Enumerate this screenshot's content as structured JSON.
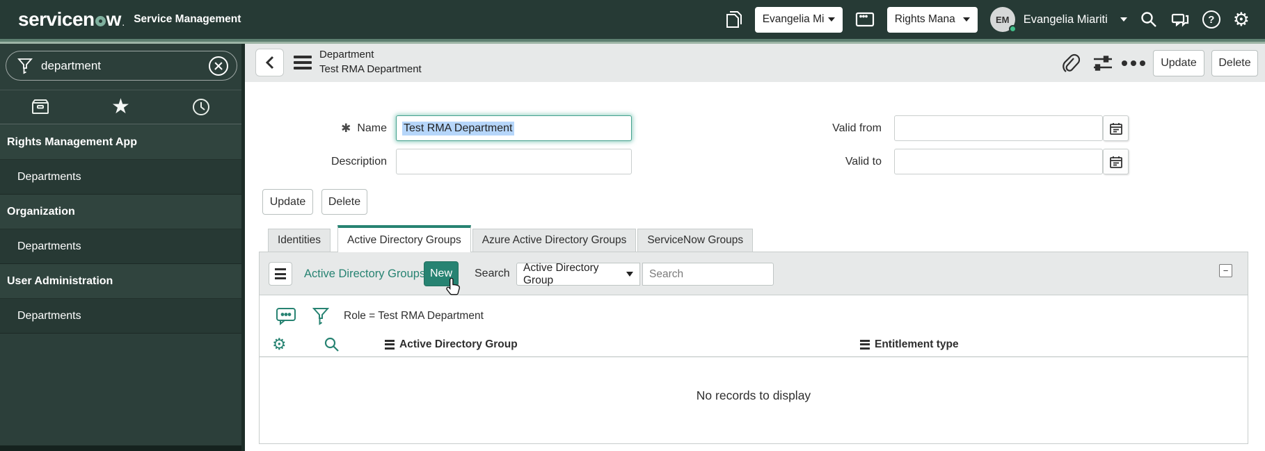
{
  "header": {
    "logo_text_pre": "servicen",
    "logo_text_post": "w",
    "logo_tm": ".",
    "product_name": "Service Management",
    "update_set_picker": "Evangelia Mi",
    "app_picker": "Rights Mana",
    "user_initials": "EM",
    "user_name": "Evangelia Miariti"
  },
  "sidebar": {
    "filter_value": "department",
    "items": [
      {
        "label": "Rights Management App",
        "type": "section"
      },
      {
        "label": "Departments",
        "type": "item"
      },
      {
        "label": "Organization",
        "type": "section"
      },
      {
        "label": "Departments",
        "type": "item"
      },
      {
        "label": "User Administration",
        "type": "section"
      },
      {
        "label": "Departments",
        "type": "item"
      }
    ]
  },
  "record_header": {
    "record_type": "Department",
    "record_title": "Test RMA Department",
    "update_label": "Update",
    "delete_label": "Delete"
  },
  "form": {
    "required_marker": "✱",
    "name_label": "Name",
    "name_value": "Test RMA Department",
    "description_label": "Description",
    "description_value": "",
    "valid_from_label": "Valid from",
    "valid_from_value": "",
    "valid_to_label": "Valid to",
    "valid_to_value": "",
    "update_label": "Update",
    "delete_label": "Delete"
  },
  "tabs": [
    {
      "label": "Identities",
      "active": false
    },
    {
      "label": "Active Directory Groups",
      "active": true
    },
    {
      "label": "Azure Active Directory Groups",
      "active": false
    },
    {
      "label": "ServiceNow Groups",
      "active": false
    }
  ],
  "related_list": {
    "title": "Active Directory Groups",
    "new_label": "New",
    "search_label": "Search",
    "search_column_selected": "Active Directory Group",
    "search_placeholder": "Search",
    "filter_condition": "Role = Test RMA Department",
    "columns": [
      "Active Directory Group",
      "Entitlement type"
    ],
    "empty_text": "No records to display",
    "collapse_glyph": "−"
  },
  "icons": {
    "topbar": [
      "pages-icon",
      "application-window-icon",
      "search-icon",
      "chat-icon",
      "help-icon",
      "gear-icon"
    ],
    "sidebar": [
      "funnel-icon",
      "clear-icon",
      "all-apps-box-icon",
      "favorites-star-icon",
      "history-clock-icon"
    ],
    "record_header": [
      "back-chevron-icon",
      "context-menu-icon",
      "paperclip-icon",
      "sliders-icon",
      "more-actions-icon"
    ],
    "related_list": [
      "list-menu-icon",
      "comment-icon",
      "filter-funnel-icon",
      "gear-icon",
      "search-icon",
      "column-menu-icon",
      "collapse-icon"
    ],
    "cursor": "hand-pointer-cursor"
  },
  "colors": {
    "accent_teal": "#278372",
    "header_bg": "#263a35",
    "sidebar_bg": "#2c3f3a",
    "selection_blue": "#b6d6fa",
    "band_green": "#5d7f70"
  }
}
